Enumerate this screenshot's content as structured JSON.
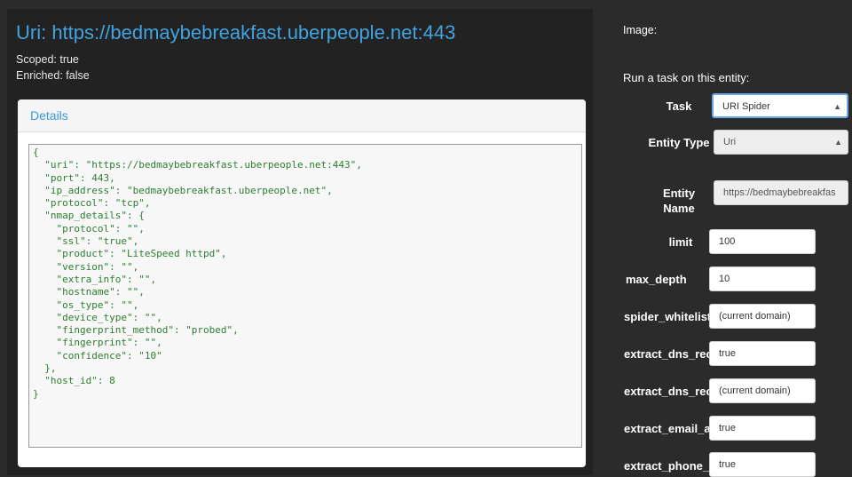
{
  "header": {
    "title": "Uri: https://bedmaybebreakfast.uberpeople.net:443",
    "scoped": "Scoped: true",
    "enriched": "Enriched: false"
  },
  "details": {
    "heading": "Details",
    "json_lines": [
      "{",
      "  \"uri\": \"https://bedmaybebreakfast.uberpeople.net:443\",",
      "  \"port\": 443,",
      "  \"ip_address\": \"bedmaybebreakfast.uberpeople.net\",",
      "  \"protocol\": \"tcp\",",
      "  \"nmap_details\": {",
      "    \"protocol\": \"\",",
      "    \"ssl\": \"true\",",
      "    \"product\": \"LiteSpeed httpd\",",
      "    \"version\": \"\",",
      "    \"extra_info\": \"\",",
      "    \"hostname\": \"\",",
      "    \"os_type\": \"\",",
      "    \"device_type\": \"\",",
      "    \"fingerprint_method\": \"probed\",",
      "    \"fingerprint\": \"\",",
      "    \"confidence\": \"10\"",
      "  },",
      "  \"host_id\": 8",
      "}"
    ]
  },
  "sidebar": {
    "image_label": "Image:",
    "run_task_label": "Run a task on this entity:",
    "task": {
      "label": "Task",
      "value": "URI Spider"
    },
    "entity_type": {
      "label": "Entity Type",
      "value": "Uri"
    },
    "entity_name": {
      "label": "Entity Name",
      "value": "https://bedmaybebreakfas"
    },
    "options": [
      {
        "label": "limit",
        "value": "100"
      },
      {
        "label": "max_depth",
        "value": "10"
      },
      {
        "label": "spider_whitelist",
        "value": "(current domain)"
      },
      {
        "label": "extract_dns_rec",
        "value": "true"
      },
      {
        "label": "extract_dns_rec",
        "value": "(current domain)"
      },
      {
        "label": "extract_email_a",
        "value": "true"
      },
      {
        "label": "extract_phone_n",
        "value": "true"
      }
    ]
  }
}
